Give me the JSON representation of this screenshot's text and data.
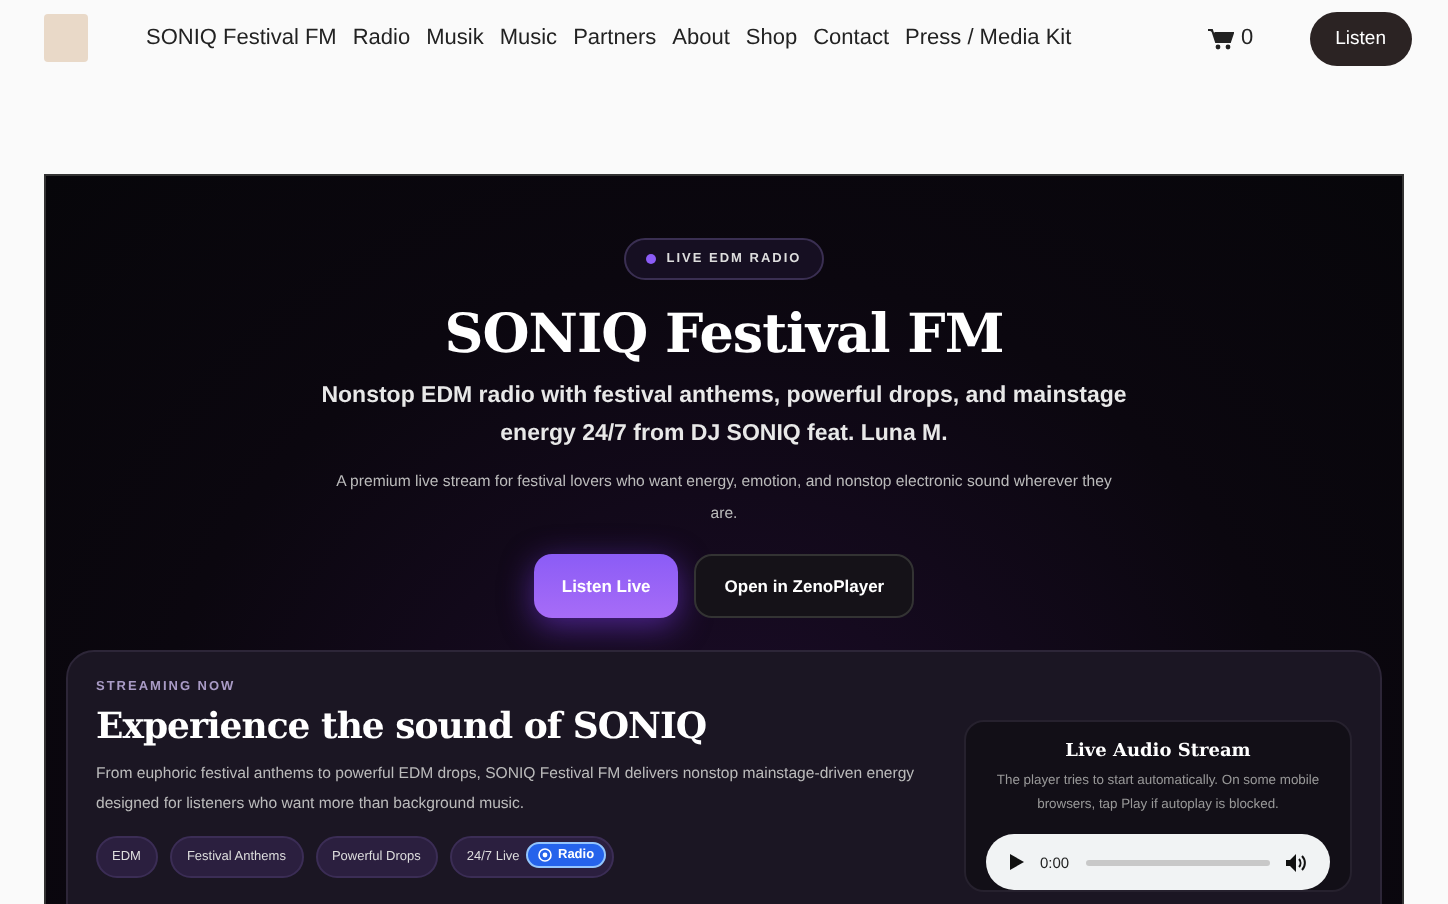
{
  "nav": {
    "links": [
      "SONIQ Festival FM",
      "Radio",
      "Musik",
      "Music",
      "Partners",
      "About",
      "Shop",
      "Contact",
      "Press / Media Kit"
    ],
    "cart_count": "0",
    "listen_button": "Listen"
  },
  "hero": {
    "badge": "LIVE EDM RADIO",
    "title": "SONIQ Festival FM",
    "subtitle": "Nonstop EDM radio with festival anthems, powerful drops, and mainstage energy 24/7 from DJ SONIQ feat. Luna M.",
    "description": "A premium live stream for festival lovers who want energy, emotion, and nonstop electronic sound wherever they are.",
    "buttons": [
      {
        "label": "Listen Live",
        "kind": "primary"
      },
      {
        "label": "Open in ZenoPlayer",
        "kind": "secondary"
      }
    ]
  },
  "stream": {
    "eyebrow": "STREAMING NOW",
    "title": "Experience the sound of SONIQ",
    "text": "From euphoric festival anthems to powerful EDM drops, SONIQ Festival FM delivers nonstop mainstage-driven energy designed for listeners who want more than background music.",
    "tags": [
      "EDM",
      "Festival Anthems",
      "Powerful Drops",
      "24/7 Live"
    ],
    "overlay_badge": "Radio",
    "player": {
      "title": "Live Audio Stream",
      "note": "The player tries to start automatically. On some mobile browsers, tap Play if autoplay is blocked.",
      "time": "0:00"
    }
  }
}
